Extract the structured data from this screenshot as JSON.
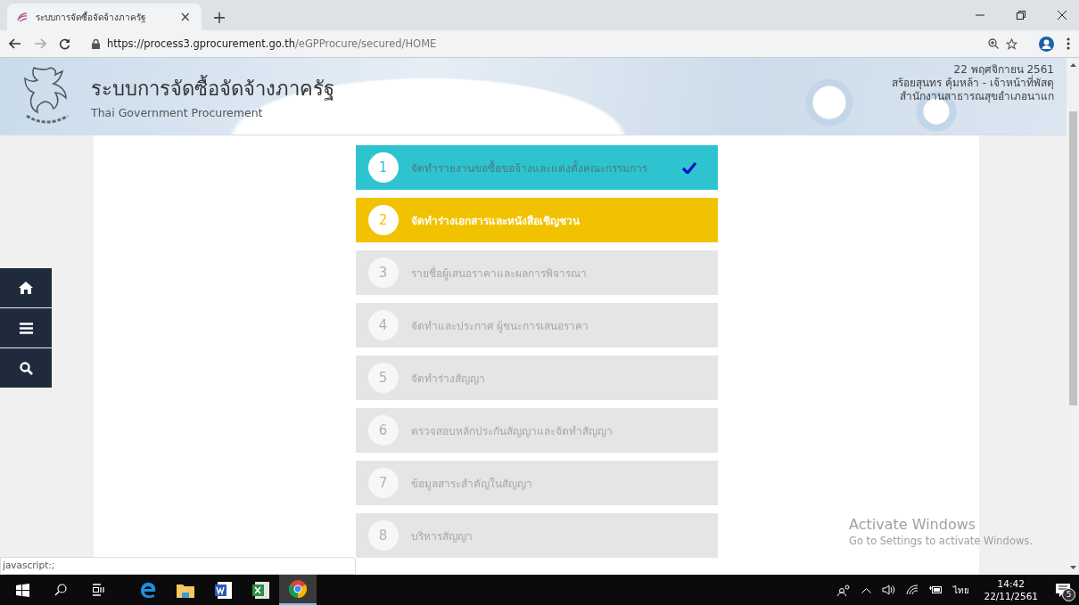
{
  "browser": {
    "tab_title": "ระบบการจัดซื้อจัดจ้างภาครัฐ",
    "close": "×",
    "new_tab": "+",
    "url_host": "https://process3.gprocurement.go.th",
    "url_path": "/eGPProcure/secured/HOME"
  },
  "header": {
    "title": "ระบบการจัดซื้อจัดจ้างภาครัฐ",
    "subtitle": "Thai Government Procurement",
    "date": "22 พฤศจิกายน 2561",
    "user": "สร้อยสุนทร คุ้มหล้า - เจ้าหน้าที่พัสดุ",
    "office": "สำนักงานสาธารณสุขอำเภอนาแก"
  },
  "side_nav": [
    {
      "kind": "home"
    },
    {
      "kind": "menu"
    },
    {
      "kind": "search"
    }
  ],
  "steps": [
    {
      "number": "1",
      "label": "จัดทำรายงานขอซื้อขอจ้างและแต่งตั้งคณะกรรมการ",
      "completed": true,
      "selected": false
    },
    {
      "number": "2",
      "label": "จัดทำร่างเอกสารและหนังสือเชิญชวน",
      "completed": false,
      "selected": true
    },
    {
      "number": "3",
      "label": "รายชื่อผู้เสนอราคาและผลการพิจารณา",
      "completed": false,
      "selected": false
    },
    {
      "number": "4",
      "label": "จัดทำและประกาศ ผู้ชนะการเสนอราคา",
      "completed": false,
      "selected": false
    },
    {
      "number": "5",
      "label": "จัดทำร่างสัญญา",
      "completed": false,
      "selected": false
    },
    {
      "number": "6",
      "label": "ตรวจสอบหลักประกันสัญญาและจัดทำสัญญา",
      "completed": false,
      "selected": false
    },
    {
      "number": "7",
      "label": "ข้อมูลสาระสำคัญในสัญญา",
      "completed": false,
      "selected": false
    },
    {
      "number": "8",
      "label": "บริหารสัญญา",
      "completed": false,
      "selected": false
    }
  ],
  "status_url": "javascript:;",
  "os_notice": {
    "title": "Activate Windows",
    "text": "Go to Settings to activate Windows."
  },
  "taskbar": {
    "apps": [
      {
        "kind": "edge",
        "active": false
      },
      {
        "kind": "explorer",
        "active": false
      },
      {
        "kind": "word",
        "active": false
      },
      {
        "kind": "excel",
        "active": false
      },
      {
        "kind": "chrome",
        "active": true
      }
    ],
    "language": "ไทย",
    "time": "14:42",
    "date": "22/11/2561",
    "notifications": "5"
  }
}
